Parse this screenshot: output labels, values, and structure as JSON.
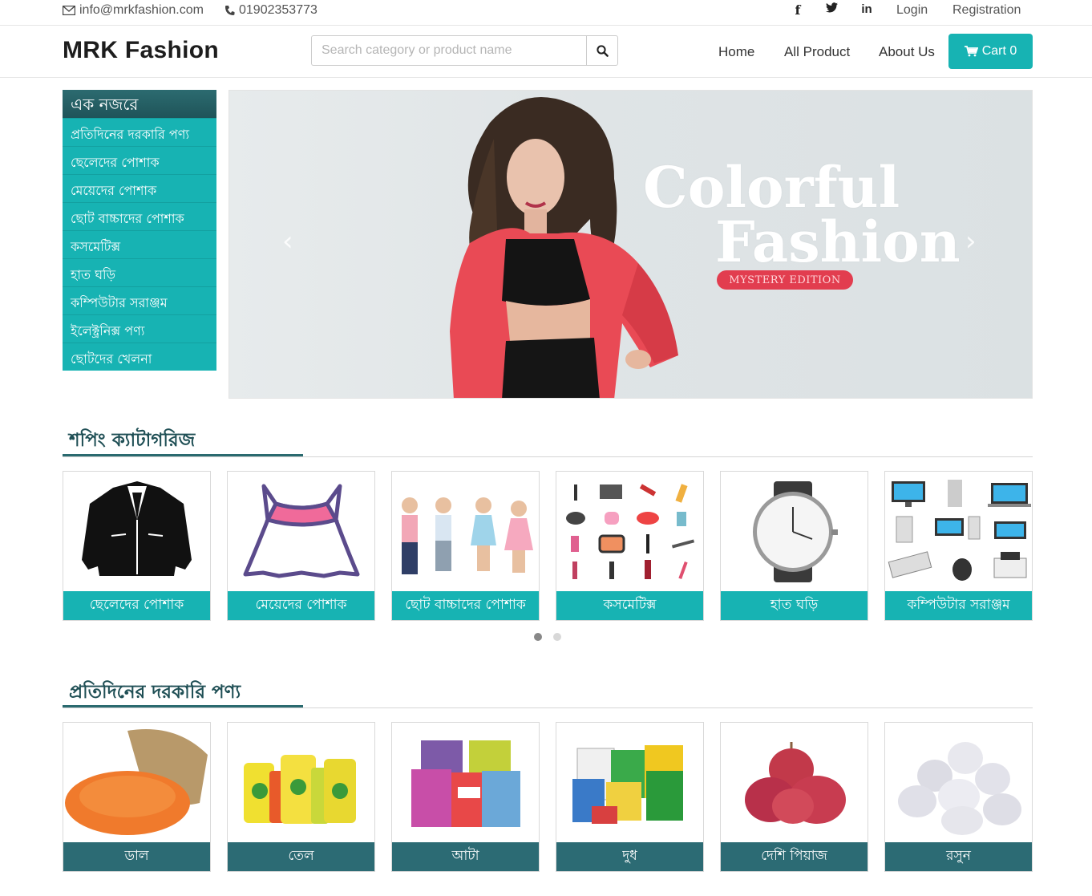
{
  "topbar": {
    "email": "info@mrkfashion.com",
    "phone": "01902353773",
    "login": "Login",
    "registration": "Registration"
  },
  "header": {
    "logo": "MRK Fashion",
    "search_placeholder": "Search category or product name",
    "nav": {
      "home": "Home",
      "all_product": "All Product",
      "about": "About Us"
    },
    "cart": "Cart 0"
  },
  "sidebar": {
    "title": "এক নজরে",
    "items": [
      "প্রতিদিনের দরকারি পণ্য",
      "ছেলেদের পোশাক",
      "মেয়েদের পোশাক",
      "ছোট বাচ্চাদের পোশাক",
      "কসমেটিক্স",
      "হাত ঘড়ি",
      "কম্পিউটার সরাঞ্জম",
      "ইলেক্ট্রনিক্স পণ্য",
      "ছোটদের খেলনা"
    ]
  },
  "slider": {
    "line1": "Colorful",
    "line2": "Fashion",
    "badge": "MYSTERY EDITION"
  },
  "shopping_categories": {
    "title": "শপিং ক্যাটাগরিজ",
    "items": [
      "ছেলেদের পোশাক",
      "মেয়েদের পোশাক",
      "ছোট বাচ্চাদের পোশাক",
      "কসমেটিক্স",
      "হাত ঘড়ি",
      "কম্পিউটার সরাঞ্জম"
    ]
  },
  "daily_products": {
    "title": "প্রতিদিনের দরকারি পণ্য",
    "items": [
      "ডাল",
      "তেল",
      "আটা",
      "দুধ",
      "দেশি পিয়াজ",
      "রসুন"
    ]
  },
  "colors": {
    "teal": "#17b3b3",
    "dark_teal": "#2c6b74",
    "title_green": "#1f4f55",
    "brand_red": "#e23d4f"
  }
}
